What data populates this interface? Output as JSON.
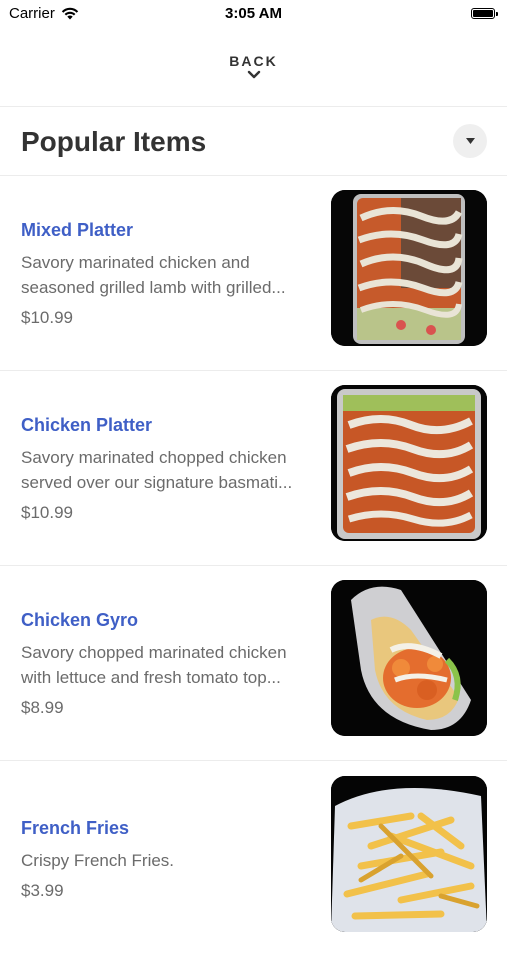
{
  "status_bar": {
    "carrier": "Carrier",
    "time": "3:05 AM",
    "battery_level": 1.0
  },
  "header": {
    "back_label": "BACK",
    "back_icon": "chevron-down-icon"
  },
  "section": {
    "title": "Popular Items",
    "dropdown_icon": "caret-down-icon"
  },
  "items": [
    {
      "name": "Mixed Platter",
      "desc_line1": "Savory marinated chicken and",
      "desc_line2": "seasoned grilled lamb with grilled...",
      "price": "$10.99",
      "image": "mixed-platter-photo"
    },
    {
      "name": "Chicken Platter",
      "desc_line1": "Savory marinated chopped chicken",
      "desc_line2": "served over our signature basmati...",
      "price": "$10.99",
      "image": "chicken-platter-photo"
    },
    {
      "name": "Chicken Gyro",
      "desc_line1": "Savory chopped marinated chicken",
      "desc_line2": "with lettuce and fresh tomato top...",
      "price": "$8.99",
      "image": "chicken-gyro-photo"
    },
    {
      "name": "French Fries",
      "desc_line1": "Crispy French Fries.",
      "desc_line2": "",
      "price": "$3.99",
      "image": "french-fries-photo"
    }
  ],
  "colors": {
    "item_name": "#3f5fc6",
    "text_secondary": "#6b6b6b",
    "title": "#333333",
    "divider": "#ececec"
  }
}
